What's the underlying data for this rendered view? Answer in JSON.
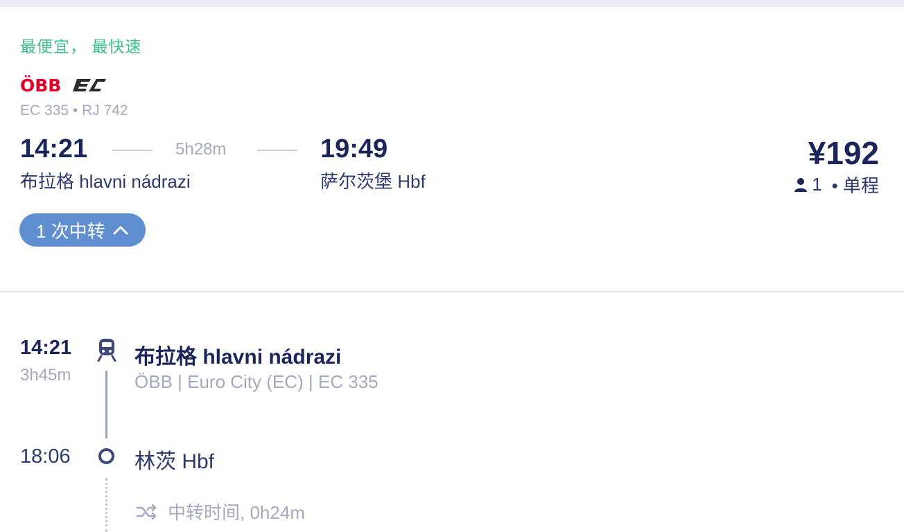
{
  "result": {
    "tag": "最便宜， 最快速",
    "operator_logo": "ÖBB",
    "brand_logo": "EC",
    "train_numbers": "EC 335 • RJ 742",
    "departure": {
      "time": "14:21",
      "station": "布拉格 hlavni nádrazi"
    },
    "duration": "5h28m",
    "arrival": {
      "time": "19:49",
      "station": "萨尔茨堡 Hbf"
    },
    "price": "¥192",
    "passengers": "1",
    "trip_type": "• 单程",
    "transfer_label": "1 次中转",
    "colors": {
      "tag": "#3fc08e",
      "pill": "#5f8fd0",
      "obb_red": "#e2002a",
      "dark": "#1b2559"
    }
  },
  "timeline": {
    "leg1": {
      "time": "14:21",
      "duration": "3h45m",
      "station": "布拉格 hlavni nádrazi",
      "details": "ÖBB | Euro City (EC) | EC 335",
      "icon": "train-icon"
    },
    "stop": {
      "time": "18:06",
      "station": "林茨 Hbf",
      "icon": "stop-circle-icon"
    },
    "transfer": {
      "icon": "shuffle-icon",
      "label": "中转时间, 0h24m"
    }
  }
}
